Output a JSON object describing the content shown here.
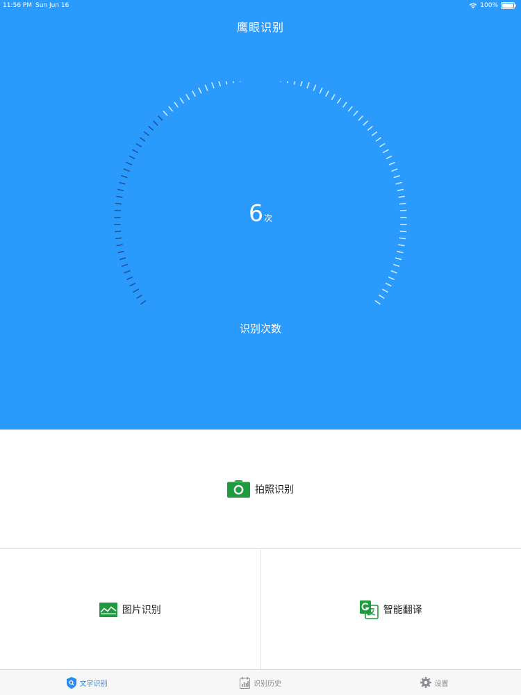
{
  "status_bar": {
    "time": "11:56 PM",
    "date": "Sun Jun 16",
    "battery": "100%"
  },
  "header": {
    "title": "鹰眼识别"
  },
  "gauge": {
    "count": "6",
    "unit": "次",
    "caption": "识别次数"
  },
  "actions": {
    "camera": {
      "label": "拍照识别",
      "icon": "camera-icon",
      "color": "#1f9a3f"
    },
    "image": {
      "label": "图片识别",
      "icon": "image-icon",
      "color": "#1f9a3f"
    },
    "translate": {
      "label": "智能翻译",
      "icon": "translate-icon",
      "color": "#1f9a3f"
    }
  },
  "tabs": [
    {
      "label": "文字识别",
      "icon": "text-recognition-icon",
      "active": true
    },
    {
      "label": "识别历史",
      "icon": "history-icon",
      "active": false
    },
    {
      "label": "设置",
      "icon": "gear-icon",
      "active": false
    }
  ],
  "colors": {
    "primary_blue": "#2a9bfd",
    "accent_green": "#1f9a3f",
    "tab_active": "#2a8bf2",
    "tab_inactive": "#8e8e93"
  }
}
